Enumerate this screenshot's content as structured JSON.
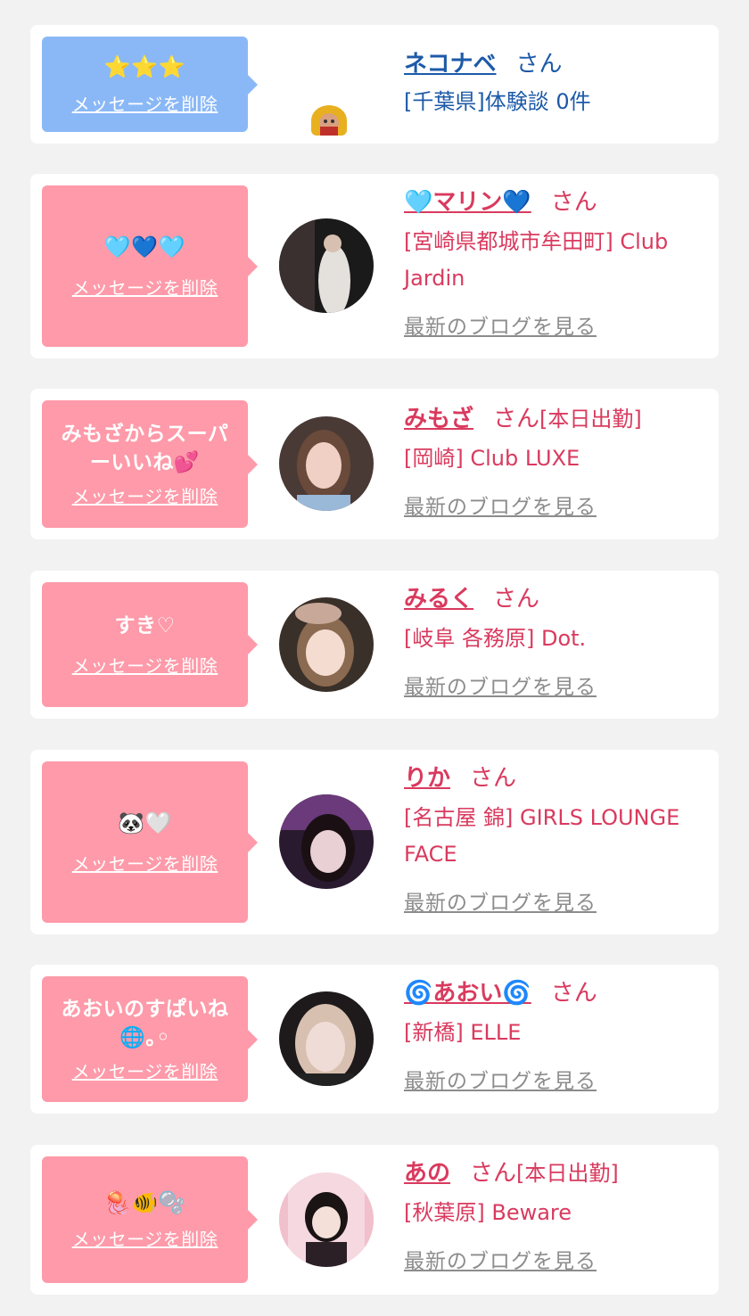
{
  "delete_label": "メッセージを削除",
  "san_label": "さん",
  "blog_label": "最新のブログを見る",
  "colors": {
    "pink_bubble": "#fe9aa9",
    "blue_bubble": "#8ab8f7",
    "pink_text": "#d93a5e",
    "blue_text": "#1d5aa8",
    "blog_link": "#8c8c8c",
    "page_bg": "#f2f2f2"
  },
  "entries": [
    {
      "message": "⭐⭐⭐",
      "name": "ネコナベ",
      "status": "",
      "shop": "[千葉県]体験談 0件"
    },
    {
      "message": "🩵💙🩵",
      "name": "🩵マリン💙",
      "status": "",
      "shop": "[宮崎県都城市牟田町] Club Jardin"
    },
    {
      "message": "みもざからスーパーいいね💕",
      "name": "みもざ",
      "status": "[本日出勤]",
      "shop": "[岡崎] Club LUXE"
    },
    {
      "message": "すき♡",
      "name": "みるく",
      "status": "",
      "shop": "[岐阜 各務原] Dot."
    },
    {
      "message": "🐼🤍",
      "name": "りか",
      "status": "",
      "shop": "[名古屋 錦] GIRLS LOUNGE FACE"
    },
    {
      "message": "あおいのすぱいね🌐｡◦",
      "name": "🌀あおい🌀",
      "status": "",
      "shop": "[新橋] ELLE"
    },
    {
      "message": "🪼🐠🫧",
      "name": "あの",
      "status": "[本日出勤]",
      "shop": "[秋葉原] Beware"
    }
  ]
}
